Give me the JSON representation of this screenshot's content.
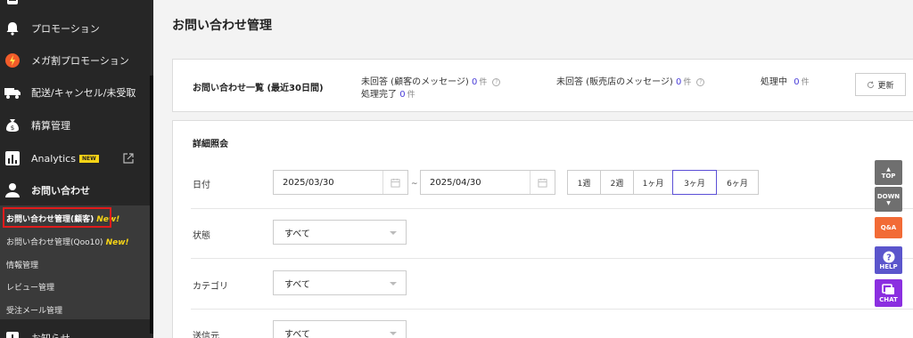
{
  "sidebar": {
    "items": [
      {
        "label": "プロモーション",
        "icon": "bell-icon"
      },
      {
        "label": "メガ割プロモーション",
        "icon": "mega-sale-icon"
      },
      {
        "label": "配送/キャンセル/未受取",
        "icon": "truck-icon"
      },
      {
        "label": "精算管理",
        "icon": "money-bag-icon"
      },
      {
        "label": "Analytics",
        "icon": "analytics-icon",
        "badge": "NEW"
      },
      {
        "label": "お問い合わせ",
        "icon": "person-icon"
      },
      {
        "label": "お知らせ",
        "icon": "notice-icon"
      }
    ],
    "submenu": [
      {
        "label": "お問い合わせ管理(顧客)",
        "new": "New!"
      },
      {
        "label": "お問い合わせ管理(Qoo10)",
        "new": "New!"
      },
      {
        "label": "情報管理"
      },
      {
        "label": "レビュー管理"
      },
      {
        "label": "受注メール管理"
      }
    ]
  },
  "page": {
    "title": "お問い合わせ管理"
  },
  "summary": {
    "title": "お問い合わせ一覧 (最近30日間)",
    "unanswered_customer": {
      "label": "未回答 (顧客のメッセージ)",
      "count": "0",
      "unit": "件"
    },
    "unanswered_shop": {
      "label": "未回答 (販売店のメッセージ)",
      "count": "0",
      "unit": "件"
    },
    "processing": {
      "label": "処理中",
      "count": "0",
      "unit": "件"
    },
    "completed": {
      "label": "処理完了",
      "count": "0",
      "unit": "件"
    },
    "refresh_label": "更新"
  },
  "detail": {
    "title": "詳細照会",
    "date_label": "日付",
    "date_from": "2025/03/30",
    "date_to": "2025/04/30",
    "date_separator": "~",
    "ranges": [
      "1週",
      "2週",
      "1ヶ月",
      "3ヶ月",
      "6ヶ月"
    ],
    "selected_range": "3ヶ月",
    "status_label": "状態",
    "status_value": "すべて",
    "category_label": "カテゴリ",
    "category_value": "すべて",
    "sender_label": "送信元",
    "sender_value": "すべて"
  },
  "floating": {
    "top": "TOP",
    "down": "DOWN",
    "qa": "Q&A",
    "help": "HELP",
    "chat": "CHAT"
  },
  "colors": {
    "sidebar_bg": "#262626",
    "accent": "#5b4fd6",
    "count_color": "#4a3ed8",
    "qa_bg": "#f26b36",
    "help_bg": "#5b55cc",
    "chat_bg": "#8b2fe0",
    "highlight": "#e21b1b"
  }
}
